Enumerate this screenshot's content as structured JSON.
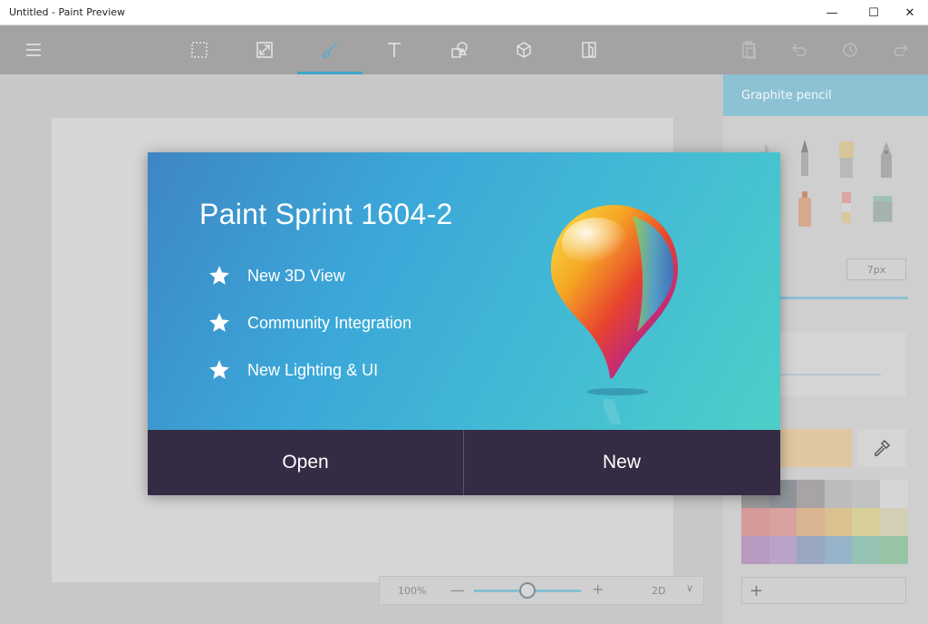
{
  "window": {
    "title": "Untitled - Paint Preview",
    "minimize_glyph": "—",
    "maximize_glyph": "☐",
    "close_glyph": "✕"
  },
  "toolbar": {
    "tools": [
      {
        "name": "menu-icon",
        "active": false
      },
      {
        "name": "select-icon",
        "active": false
      },
      {
        "name": "crop-icon",
        "active": false
      },
      {
        "name": "brush-icon",
        "active": true
      },
      {
        "name": "text-icon",
        "active": false
      },
      {
        "name": "shapes-icon",
        "active": false
      },
      {
        "name": "3d-cube-icon",
        "active": false
      },
      {
        "name": "sticker-icon",
        "active": false
      },
      {
        "name": "paste-icon",
        "active": false
      },
      {
        "name": "undo-icon",
        "active": false
      },
      {
        "name": "history-icon",
        "active": false
      },
      {
        "name": "redo-icon",
        "active": false
      }
    ],
    "accent_color": "#3aa6c8"
  },
  "panel": {
    "title": "Graphite pencil",
    "size_value": "7px",
    "add_glyph": "+",
    "palette": [
      "#9a9a9a",
      "#8e949a",
      "#a8a4a6",
      "#bcbcbc",
      "#c2c2c2",
      "#d6d6d6",
      "#d69a9a",
      "#d9a2a0",
      "#d8b590",
      "#d9c290",
      "#d7cf9a",
      "#d3cfb7",
      "#b79abf",
      "#b9a3c6",
      "#99a7c0",
      "#97b3c9",
      "#95c3b3",
      "#96c4a5"
    ],
    "color_swatch": "#dfc7a0"
  },
  "zoom": {
    "value": "100%",
    "minus": "—",
    "plus": "+",
    "level": 0.5,
    "mode": "2D",
    "chevron": "∨"
  },
  "dialog": {
    "title": "Paint Sprint 1604-2",
    "features": [
      "New 3D View",
      "Community Integration",
      "New Lighting & UI"
    ],
    "open_label": "Open",
    "new_label": "New",
    "footer_color": "#352b45"
  }
}
